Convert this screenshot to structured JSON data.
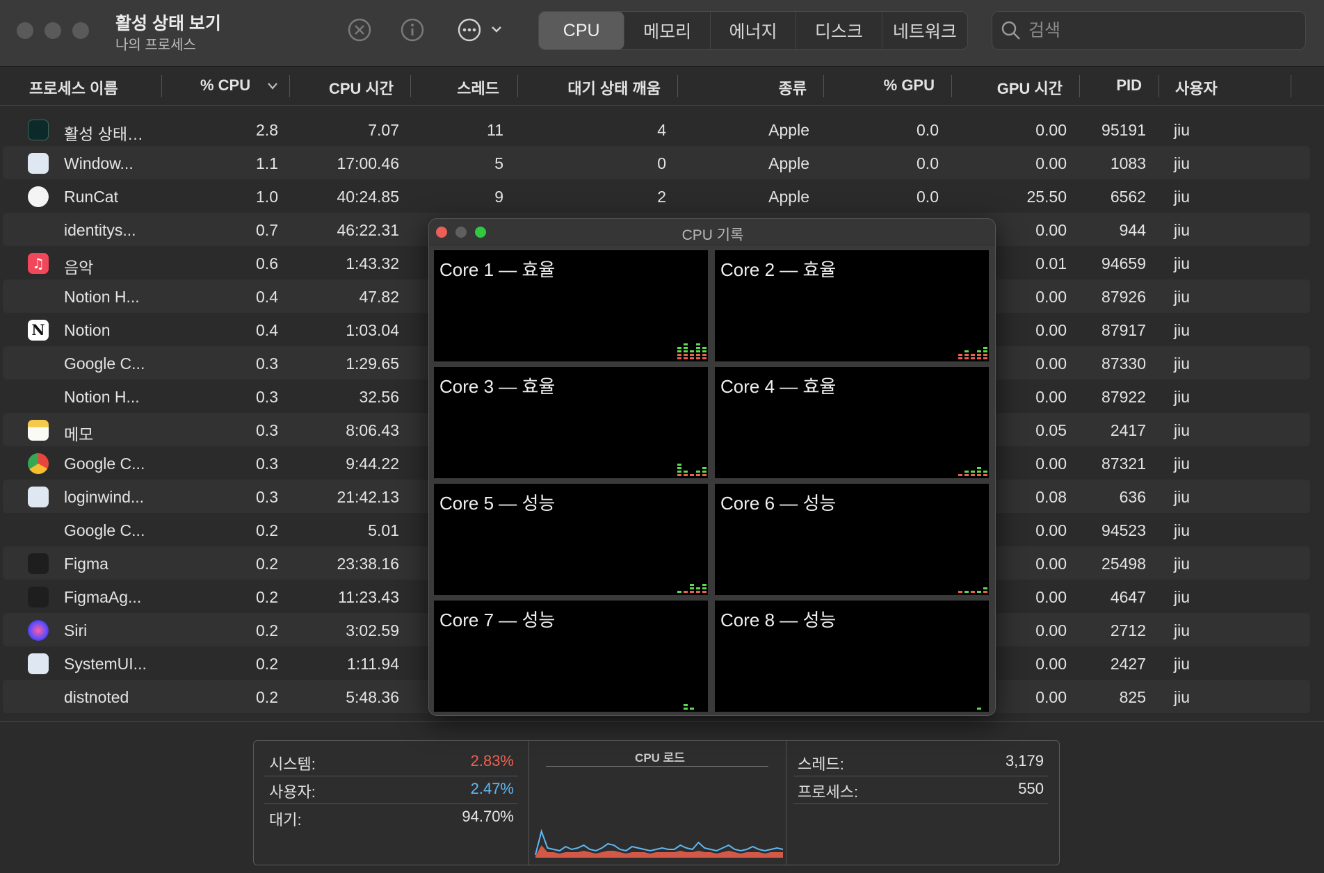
{
  "window": {
    "title": "활성 상태 보기",
    "subtitle": "나의 프로세스"
  },
  "toolbar": {
    "tabs": [
      "CPU",
      "메모리",
      "에너지",
      "디스크",
      "네트워크"
    ],
    "active_tab": "CPU",
    "search_placeholder": "검색"
  },
  "columns": {
    "name": "프로세스 이름",
    "cpu": "% CPU",
    "cpu_time": "CPU 시간",
    "threads": "스레드",
    "idle_wake": "대기 상태 깨움",
    "kind": "종류",
    "gpu": "% GPU",
    "gpu_time": "GPU 시간",
    "pid": "PID",
    "user": "사용자"
  },
  "rows": [
    {
      "icon": "activity-monitor-icon",
      "name": "활성 상태…",
      "cpu": "2.8",
      "cpu_time": "7.07",
      "threads": "11",
      "idle_wake": "4",
      "kind": "Apple",
      "gpu": "0.0",
      "gpu_time": "0.00",
      "pid": "95191",
      "user": "jiu"
    },
    {
      "icon": "window-server-icon",
      "name": "Window...",
      "cpu": "1.1",
      "cpu_time": "17:00.46",
      "threads": "5",
      "idle_wake": "0",
      "kind": "Apple",
      "gpu": "0.0",
      "gpu_time": "0.00",
      "pid": "1083",
      "user": "jiu"
    },
    {
      "icon": "runcat-icon",
      "name": "RunCat",
      "cpu": "1.0",
      "cpu_time": "40:24.85",
      "threads": "9",
      "idle_wake": "2",
      "kind": "Apple",
      "gpu": "0.0",
      "gpu_time": "25.50",
      "pid": "6562",
      "user": "jiu"
    },
    {
      "icon": "",
      "name": "identitys...",
      "cpu": "0.7",
      "cpu_time": "46:22.31",
      "threads": "",
      "idle_wake": "",
      "kind": "",
      "gpu": "",
      "gpu_time": "0.00",
      "pid": "944",
      "user": "jiu"
    },
    {
      "icon": "music-icon",
      "name": "음악",
      "cpu": "0.6",
      "cpu_time": "1:43.32",
      "threads": "",
      "idle_wake": "",
      "kind": "",
      "gpu": "",
      "gpu_time": "0.01",
      "pid": "94659",
      "user": "jiu"
    },
    {
      "icon": "",
      "name": "Notion H...",
      "cpu": "0.4",
      "cpu_time": "47.82",
      "threads": "",
      "idle_wake": "",
      "kind": "",
      "gpu": "",
      "gpu_time": "0.00",
      "pid": "87926",
      "user": "jiu"
    },
    {
      "icon": "notion-icon",
      "name": "Notion",
      "cpu": "0.4",
      "cpu_time": "1:03.04",
      "threads": "",
      "idle_wake": "",
      "kind": "",
      "gpu": "",
      "gpu_time": "0.00",
      "pid": "87917",
      "user": "jiu"
    },
    {
      "icon": "",
      "name": "Google C...",
      "cpu": "0.3",
      "cpu_time": "1:29.65",
      "threads": "",
      "idle_wake": "",
      "kind": "",
      "gpu": "",
      "gpu_time": "0.00",
      "pid": "87330",
      "user": "jiu"
    },
    {
      "icon": "",
      "name": "Notion H...",
      "cpu": "0.3",
      "cpu_time": "32.56",
      "threads": "",
      "idle_wake": "",
      "kind": "",
      "gpu": "",
      "gpu_time": "0.00",
      "pid": "87922",
      "user": "jiu"
    },
    {
      "icon": "notes-icon",
      "name": "메모",
      "cpu": "0.3",
      "cpu_time": "8:06.43",
      "threads": "",
      "idle_wake": "",
      "kind": "",
      "gpu": "",
      "gpu_time": "0.05",
      "pid": "2417",
      "user": "jiu"
    },
    {
      "icon": "chrome-icon",
      "name": "Google C...",
      "cpu": "0.3",
      "cpu_time": "9:44.22",
      "threads": "",
      "idle_wake": "",
      "kind": "",
      "gpu": "",
      "gpu_time": "0.00",
      "pid": "87321",
      "user": "jiu"
    },
    {
      "icon": "loginwindow-icon",
      "name": "loginwind...",
      "cpu": "0.3",
      "cpu_time": "21:42.13",
      "threads": "",
      "idle_wake": "",
      "kind": "",
      "gpu": "",
      "gpu_time": "0.08",
      "pid": "636",
      "user": "jiu"
    },
    {
      "icon": "",
      "name": "Google C...",
      "cpu": "0.2",
      "cpu_time": "5.01",
      "threads": "",
      "idle_wake": "",
      "kind": "",
      "gpu": "",
      "gpu_time": "0.00",
      "pid": "94523",
      "user": "jiu"
    },
    {
      "icon": "figma-icon",
      "name": "Figma",
      "cpu": "0.2",
      "cpu_time": "23:38.16",
      "threads": "",
      "idle_wake": "",
      "kind": "",
      "gpu": "",
      "gpu_time": "0.00",
      "pid": "25498",
      "user": "jiu"
    },
    {
      "icon": "figma-agent-icon",
      "name": "FigmaAg...",
      "cpu": "0.2",
      "cpu_time": "11:23.43",
      "threads": "",
      "idle_wake": "",
      "kind": "",
      "gpu": "",
      "gpu_time": "0.00",
      "pid": "4647",
      "user": "jiu"
    },
    {
      "icon": "siri-icon",
      "name": "Siri",
      "cpu": "0.2",
      "cpu_time": "3:02.59",
      "threads": "",
      "idle_wake": "",
      "kind": "",
      "gpu": "",
      "gpu_time": "0.00",
      "pid": "2712",
      "user": "jiu"
    },
    {
      "icon": "system-ui-icon",
      "name": "SystemUI...",
      "cpu": "0.2",
      "cpu_time": "1:11.94",
      "threads": "",
      "idle_wake": "",
      "kind": "",
      "gpu": "",
      "gpu_time": "0.00",
      "pid": "2427",
      "user": "jiu"
    },
    {
      "icon": "",
      "name": "distnoted",
      "cpu": "0.2",
      "cpu_time": "5:48.36",
      "threads": "",
      "idle_wake": "",
      "kind": "",
      "gpu": "",
      "gpu_time": "0.00",
      "pid": "825",
      "user": "jiu"
    }
  ],
  "cpu_history": {
    "title": "CPU 기록",
    "cores": [
      {
        "label": "Core 1 — 효율",
        "green": [
          2,
          3,
          1,
          3,
          2
        ],
        "red": [
          2,
          2,
          2,
          2,
          2
        ]
      },
      {
        "label": "Core 2 — 효율",
        "green": [
          0,
          1,
          0,
          1,
          2
        ],
        "red": [
          2,
          2,
          2,
          2,
          2
        ]
      },
      {
        "label": "Core 3 — 효율",
        "green": [
          3,
          1,
          0,
          1,
          2
        ],
        "red": [
          1,
          1,
          1,
          1,
          1
        ]
      },
      {
        "label": "Core 4 — 효율",
        "green": [
          0,
          1,
          1,
          2,
          1
        ],
        "red": [
          1,
          1,
          1,
          1,
          1
        ]
      },
      {
        "label": "Core 5 — 성능",
        "green": [
          1,
          0,
          2,
          1,
          2
        ],
        "red": [
          0,
          1,
          1,
          1,
          1
        ]
      },
      {
        "label": "Core 6 — 성능",
        "green": [
          0,
          1,
          0,
          1,
          1
        ],
        "red": [
          1,
          0,
          1,
          0,
          1
        ]
      },
      {
        "label": "Core 7 — 성능",
        "green": [
          0,
          2,
          1,
          0,
          0
        ],
        "red": [
          0,
          0,
          0,
          0,
          0
        ]
      },
      {
        "label": "Core 8 — 성능",
        "green": [
          0,
          0,
          0,
          1,
          0
        ],
        "red": [
          0,
          0,
          0,
          0,
          0
        ]
      }
    ]
  },
  "stats": {
    "system_label": "시스템:",
    "system_value": "2.83%",
    "user_label": "사용자:",
    "user_value": "2.47%",
    "idle_label": "대기:",
    "idle_value": "94.70%",
    "cpu_load_title": "CPU 로드",
    "threads_label": "스레드:",
    "threads_value": "3,179",
    "processes_label": "프로세스:",
    "processes_value": "550",
    "cpu_load_user": [
      0.1,
      0.95,
      0.35,
      0.3,
      0.25,
      0.4,
      0.3,
      0.35,
      0.45,
      0.3,
      0.25,
      0.35,
      0.5,
      0.45,
      0.3,
      0.25,
      0.4,
      0.35,
      0.3,
      0.25,
      0.3,
      0.35,
      0.3,
      0.3,
      0.45,
      0.35,
      0.3,
      0.55,
      0.35,
      0.3,
      0.25,
      0.35,
      0.45,
      0.3,
      0.25,
      0.3,
      0.4,
      0.3,
      0.25,
      0.3,
      0.35,
      0.3
    ],
    "cpu_load_system": [
      0.05,
      0.45,
      0.2,
      0.2,
      0.15,
      0.2,
      0.2,
      0.2,
      0.25,
      0.2,
      0.15,
      0.2,
      0.25,
      0.25,
      0.2,
      0.15,
      0.2,
      0.2,
      0.2,
      0.15,
      0.2,
      0.2,
      0.2,
      0.2,
      0.25,
      0.2,
      0.2,
      0.25,
      0.2,
      0.2,
      0.15,
      0.2,
      0.25,
      0.2,
      0.15,
      0.2,
      0.2,
      0.2,
      0.15,
      0.2,
      0.2,
      0.2
    ]
  },
  "colors": {
    "system": "#f0604e",
    "user": "#5fb8f4",
    "graph_green": "#5ddb4f",
    "graph_red": "#f0604e"
  }
}
